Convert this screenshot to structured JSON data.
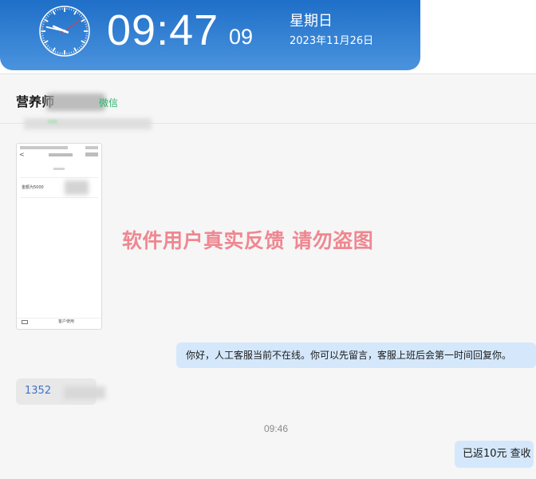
{
  "clock": {
    "time": "09:47",
    "seconds": "09",
    "weekday": "星期日",
    "date": "2023年11月26日",
    "analog": {
      "hour": 9,
      "minute": 47,
      "second": 9
    }
  },
  "chat": {
    "contact_name": "营养师",
    "contact_source": "微信",
    "image_message": {
      "card_text": "金额为5000",
      "bottom_label": "客户使用"
    },
    "watermark": "软件用户真实反馈 请勿盗图",
    "messages": [
      {
        "side": "right",
        "text": "你好，人工客服当前不在线。你可以先留言，客服上班后会第一时间回复你。"
      },
      {
        "side": "left",
        "text": "1352"
      },
      {
        "side": "right",
        "text": "已返10元 查收"
      }
    ],
    "timestamp": "09:46"
  },
  "colors": {
    "banner_top": "#1f6fc8",
    "banner_bottom": "#4a93de",
    "bubble_right": "#d5e8fb",
    "bubble_left": "#e8e8e8",
    "watermark": "#ec5c68",
    "source_green": "#2fb36b"
  }
}
